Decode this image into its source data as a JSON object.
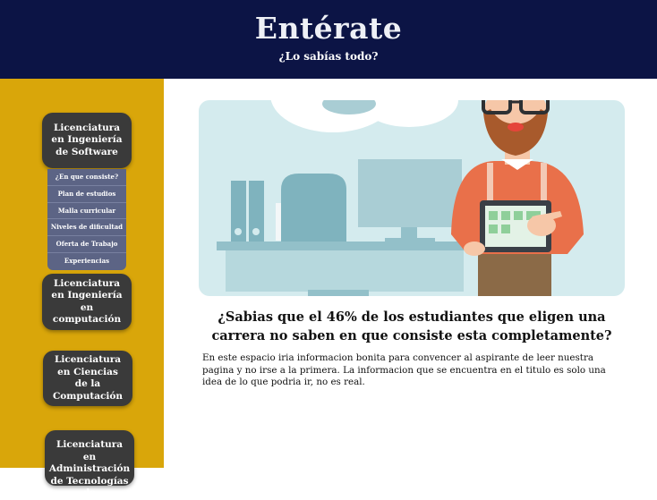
{
  "header": {
    "title": "Entérate",
    "subtitle": "¿Lo sabías todo?"
  },
  "sidebar": {
    "cards": [
      {
        "label": "Licenciatura en Ingeniería de Software"
      },
      {
        "label": "Licenciatura en Ingeniería en computación"
      },
      {
        "label": "Licenciatura en Ciencias de la Computación"
      },
      {
        "label": "Licenciatura en Administración de Tecnologías de"
      }
    ],
    "submenu": [
      {
        "label": "¿En que consiste?"
      },
      {
        "label": "Plan de estudios"
      },
      {
        "label": "Malla curricular"
      },
      {
        "label": "Niveles de dificultad"
      },
      {
        "label": "Oferta de Trabajo"
      },
      {
        "label": "Experiencias"
      }
    ]
  },
  "main": {
    "headline": "¿Sabias que el 46% de los estudiantes que eligen una carrera no saben en que consiste esta completamente?",
    "paragraph": "En este espacio iria informacion bonita para convencer al aspirante de leer nuestra pagina y no irse a la primera. La informacion que se encuentra en el titulo es solo una idea de lo que podria ir, no es real."
  },
  "colors": {
    "header_bg": "#0c1445",
    "sidebar_bg": "#d9a60a",
    "card_bg": "#3a3a3a",
    "submenu_bg": "#5c6485",
    "hero_bg": "#d4ebee"
  }
}
